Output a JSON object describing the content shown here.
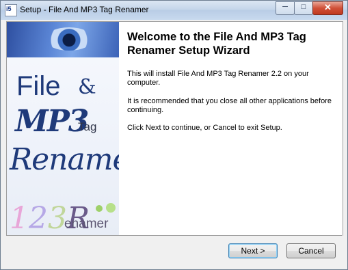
{
  "window": {
    "title": "Setup - File And MP3 Tag Renamer",
    "icon": "installer-app-icon",
    "caption_buttons": {
      "minimize": "─",
      "maximize": "□",
      "close": "✕"
    }
  },
  "side_image": {
    "line1": "File",
    "amp": "&",
    "line2": "MP3",
    "tag": "Tag",
    "line3": "Renamer",
    "brand_digits": [
      "1",
      "2",
      "3"
    ],
    "brand_r": "R",
    "brand_word": "enamer"
  },
  "main": {
    "heading_line1": "Welcome to the File And MP3 Tag",
    "heading_line2": "Renamer Setup Wizard",
    "para1_line1": "This will install File And MP3 Tag Renamer 2.2 on your",
    "para1_line2": "computer.",
    "para2_line1": "It is recommended that you close all other applications before",
    "para2_line2": "continuing.",
    "para3": "Click Next to continue, or Cancel to exit Setup."
  },
  "buttons": {
    "next": "Next >",
    "cancel": "Cancel"
  }
}
